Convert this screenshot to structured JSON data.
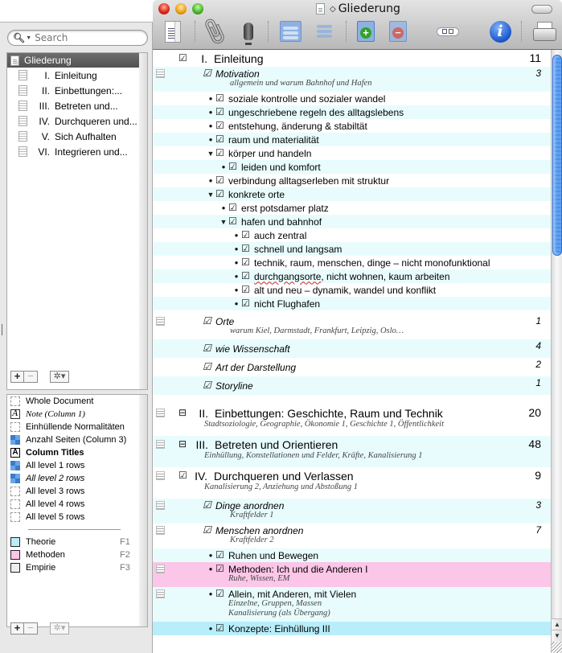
{
  "window": {
    "title": "Gliederung"
  },
  "toolbar": {
    "items": [
      {
        "name": "outline-view",
        "label": "Outline View"
      },
      {
        "name": "attach",
        "label": "Attach"
      },
      {
        "name": "record",
        "label": "Record"
      },
      {
        "name": "group",
        "label": "Group"
      },
      {
        "name": "ungroup",
        "label": "Ungroup"
      },
      {
        "name": "add-column",
        "label": "Add Column"
      },
      {
        "name": "remove-column",
        "label": "Remove Column"
      },
      {
        "name": "view-mode",
        "label": "View Mode"
      },
      {
        "name": "info",
        "label": "Info",
        "glyph": "i"
      },
      {
        "name": "print",
        "label": "Print"
      }
    ]
  },
  "sidebar": {
    "search_placeholder": "Search",
    "outline": {
      "root": "Gliederung",
      "items": [
        {
          "num": "I.",
          "label": "Einleitung"
        },
        {
          "num": "II.",
          "label": "Einbettungen:..."
        },
        {
          "num": "III.",
          "label": "Betreten und..."
        },
        {
          "num": "IV.",
          "label": "Durchqueren und..."
        },
        {
          "num": "V.",
          "label": "Sich Aufhalten"
        },
        {
          "num": "VI.",
          "label": "Integrieren und..."
        }
      ]
    },
    "styles": [
      {
        "label": "Whole Document",
        "swatch": "dashed",
        "style": ""
      },
      {
        "label": "Note (Column 1)",
        "swatch": "letter-italic",
        "glyph": "A",
        "style": "italic-serif"
      },
      {
        "label": "Einhüllende Normalitäten",
        "swatch": "dashed",
        "style": ""
      },
      {
        "label": "Anzahl Seiten (Column 3)",
        "swatch": "check",
        "style": ""
      },
      {
        "label": "Column Titles",
        "swatch": "letter-bold",
        "glyph": "A",
        "style": "bold"
      },
      {
        "label": "All level 1 rows",
        "swatch": "check",
        "style": ""
      },
      {
        "label": "All level 2 rows",
        "swatch": "check",
        "style": "italic"
      },
      {
        "label": "All level 3 rows",
        "swatch": "dashed",
        "style": ""
      },
      {
        "label": "All level 4 rows",
        "swatch": "dashed",
        "style": ""
      },
      {
        "label": "All level 5 rows",
        "swatch": "dashed",
        "style": ""
      }
    ],
    "labels": [
      {
        "name": "Theorie",
        "key": "F1",
        "color": "#b8eefa"
      },
      {
        "name": "Methoden",
        "key": "F2",
        "color": "#fbc6e8"
      },
      {
        "name": "Empirie",
        "key": "F3",
        "color": "#eeeeee"
      }
    ],
    "buttons": {
      "add": "+",
      "remove": "−",
      "gear": "✲▾"
    }
  },
  "outline_rows": [
    {
      "level": 1,
      "checked": true,
      "num": "I.",
      "title": "Einleitung",
      "count": "11",
      "bg": "white"
    },
    {
      "level": 2,
      "checked": true,
      "title": "Motivation",
      "count": "3",
      "note": [
        "allgemein und warum Bahnhof und Hafen"
      ],
      "has_note": true,
      "bg": "alt"
    },
    {
      "level": 3,
      "indent": 0,
      "marker": "bullet",
      "checked": true,
      "title": "soziale kontrolle und sozialer wandel",
      "bg": "white"
    },
    {
      "level": 3,
      "indent": 0,
      "marker": "bullet",
      "checked": true,
      "title": "ungeschriebene regeln des alltagslebens",
      "bg": "alt"
    },
    {
      "level": 3,
      "indent": 0,
      "marker": "bullet",
      "checked": true,
      "title": "entstehung, änderung & stabiltät",
      "bg": "white"
    },
    {
      "level": 3,
      "indent": 0,
      "marker": "bullet",
      "checked": true,
      "title": "raum und materialität",
      "bg": "alt"
    },
    {
      "level": 3,
      "indent": 0,
      "marker": "triangle",
      "checked": true,
      "title": "körper und handeln",
      "bg": "white"
    },
    {
      "level": 3,
      "indent": 1,
      "marker": "bullet",
      "checked": true,
      "title": "leiden und komfort",
      "bg": "alt"
    },
    {
      "level": 3,
      "indent": 0,
      "marker": "bullet",
      "checked": true,
      "title": "verbindung alltagserleben mit struktur",
      "bg": "white"
    },
    {
      "level": 3,
      "indent": 0,
      "marker": "triangle",
      "checked": true,
      "title": "konkrete orte",
      "bg": "alt"
    },
    {
      "level": 3,
      "indent": 1,
      "marker": "bullet",
      "checked": true,
      "title": "erst potsdamer platz",
      "bg": "white"
    },
    {
      "level": 3,
      "indent": 1,
      "marker": "triangle",
      "checked": true,
      "title": "hafen und bahnhof",
      "bg": "alt"
    },
    {
      "level": 3,
      "indent": 2,
      "marker": "bullet",
      "checked": true,
      "title": "auch zentral",
      "bg": "white"
    },
    {
      "level": 3,
      "indent": 2,
      "marker": "bullet",
      "checked": true,
      "title": "schnell und langsam",
      "bg": "alt"
    },
    {
      "level": 3,
      "indent": 2,
      "marker": "bullet",
      "checked": true,
      "title": "technik, raum, menschen, dinge – nicht monofunktional",
      "bg": "white"
    },
    {
      "level": 3,
      "indent": 2,
      "marker": "bullet",
      "checked": true,
      "title": "durchgangsorte, nicht wohnen, kaum arbeiten",
      "spell": "durchgangsorte",
      "bg": "alt"
    },
    {
      "level": 3,
      "indent": 2,
      "marker": "bullet",
      "checked": true,
      "title": "alt und neu – dynamik, wandel und konflikt",
      "bg": "white"
    },
    {
      "level": 3,
      "indent": 2,
      "marker": "bullet",
      "checked": true,
      "title": "nicht Flughafen",
      "bg": "alt"
    },
    {
      "level": 2,
      "checked": true,
      "title": "Orte",
      "count": "1",
      "note": [
        "warum Kiel, Darmstadt, Frankfurt, Leipzig, Oslo…"
      ],
      "has_note": true,
      "bg": "white",
      "gap_before": true
    },
    {
      "level": 2,
      "checked": true,
      "title": "wie Wissenschaft",
      "count": "4",
      "bg": "alt"
    },
    {
      "level": 2,
      "checked": true,
      "title": "Art der Darstellung",
      "count": "2",
      "bg": "white"
    },
    {
      "level": 2,
      "checked": true,
      "title": "Storyline",
      "count": "1",
      "bg": "alt"
    },
    {
      "level": 1,
      "box": "minus",
      "num": "II.",
      "title": "Einbettungen: Geschichte, Raum und Technik",
      "count": "20",
      "note": [
        "Stadtsoziologie, Geographie, Ökonomie 1, Geschichte 1, Öffentlichkeit"
      ],
      "has_note": true,
      "bg": "white",
      "gap_before": true
    },
    {
      "level": 1,
      "box": "minus",
      "num": "III.",
      "title": "Betreten und Orientieren",
      "count": "48",
      "note": [
        "Einhüllung, Konstellationen und Felder, Kräfte, Kanalisierung 1"
      ],
      "has_note": true,
      "bg": "alt"
    },
    {
      "level": 1,
      "checked": true,
      "num": "IV.",
      "title": "Durchqueren und Verlassen",
      "count": "9",
      "note": [
        "Kanalisierung 2, Anziehung und Abstoßung 1"
      ],
      "has_note": true,
      "bg": "white"
    },
    {
      "level": 2,
      "checked": true,
      "title": "Dinge anordnen",
      "count": "3",
      "note": [
        "Kraftfelder 1"
      ],
      "has_note": true,
      "bg": "alt"
    },
    {
      "level": 2,
      "checked": true,
      "title": "Menschen anordnen",
      "count": "7",
      "note": [
        "Kraftfelder 2"
      ],
      "has_note": true,
      "bg": "white"
    },
    {
      "level": 3,
      "indent": 0,
      "marker": "bullet",
      "checked": true,
      "title": "Ruhen und Bewegen",
      "bg": "alt"
    },
    {
      "level": 3,
      "indent": 0,
      "marker": "bullet",
      "checked": true,
      "title": "Methoden: Ich und die Anderen I",
      "note": [
        "Ruhe, Wissen, EM"
      ],
      "has_note": true,
      "bg": "pink"
    },
    {
      "level": 3,
      "indent": 0,
      "marker": "bullet",
      "checked": true,
      "title": "Allein, mit Anderen, mit Vielen",
      "note": [
        "Einzelne, Gruppen, Massen",
        "Kanalisierung (als Übergang)"
      ],
      "has_note": true,
      "bg": "alt"
    },
    {
      "level": 3,
      "indent": 0,
      "marker": "bullet",
      "checked": true,
      "title": "Konzepte: Einhüllung III",
      "bg": "blue"
    }
  ],
  "scrollbar": {
    "position_fraction": 0.0,
    "visible_fraction": 0.33
  }
}
